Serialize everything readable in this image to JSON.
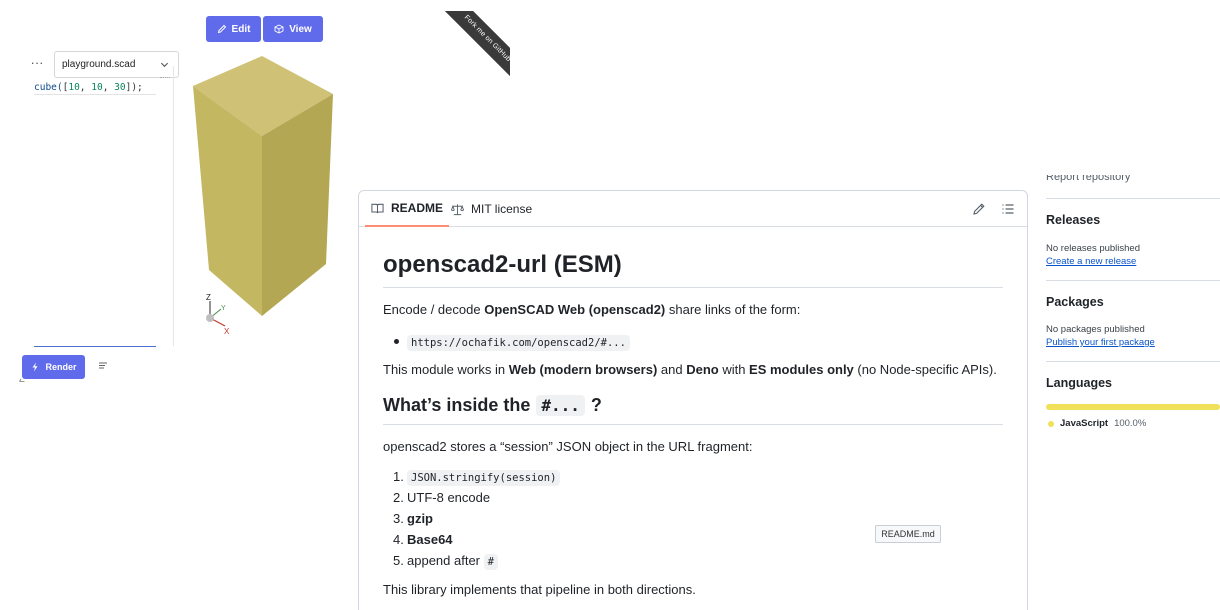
{
  "playground": {
    "more_label": "···",
    "file_select": "playground.scad",
    "code": {
      "fn": "cube(",
      "open": "[",
      "n1": "10",
      "sep1": ", ",
      "n2": "10",
      "sep2": ", ",
      "n3": "30",
      "close": "]);"
    },
    "edit_label": "Edit",
    "view_label": "View",
    "render_label": "Render",
    "axes": {
      "z": "Z",
      "y": "Y",
      "x": "X"
    },
    "model_color": "#cfc276"
  },
  "ribbon": {
    "text": "Fork me on GitHub"
  },
  "readme": {
    "tabs": [
      {
        "label": "README",
        "icon": "book-icon"
      },
      {
        "label": "MIT license",
        "icon": "scale-icon"
      }
    ],
    "title": "openscad2-url (ESM)",
    "intro": {
      "pre": "Encode / decode ",
      "b1": "OpenSCAD Web (openscad2)",
      "post": " share links of the form:"
    },
    "bullet_code": "https://ochafik.com/openscad2/#...",
    "module": {
      "pre": "This module works in ",
      "b1": "Web (modern browsers)",
      "mid1": " and ",
      "b2": "Deno",
      "mid2": " with ",
      "b3": "ES modules only",
      "post": " (no Node-specific APIs)."
    },
    "h2_text": "What’s inside the",
    "h2_code": "#...",
    "h2_q": "?",
    "session_line": "openscad2 stores a “session” JSON object in the URL fragment:",
    "steps": [
      {
        "n": "1.",
        "code": "JSON.stringify(session)"
      },
      {
        "n": "2.",
        "text": "UTF-8 encode"
      },
      {
        "n": "3.",
        "bold": "gzip"
      },
      {
        "n": "4.",
        "bold": "Base64"
      },
      {
        "n": "5.",
        "text": "append after ",
        "code": "#"
      }
    ],
    "closing": "This library implements that pipeline in both directions.",
    "tooltip": "README.md"
  },
  "sidebar": {
    "report": "Report repository",
    "releases_title": "Releases",
    "releases_none": "No releases published",
    "releases_link": "Create a new release",
    "packages_title": "Packages",
    "packages_none": "No packages published",
    "packages_link": "Publish your first package",
    "languages_title": "Languages",
    "language_name": "JavaScript",
    "language_pct": "100.0%",
    "language_color": "#f1e05a"
  }
}
